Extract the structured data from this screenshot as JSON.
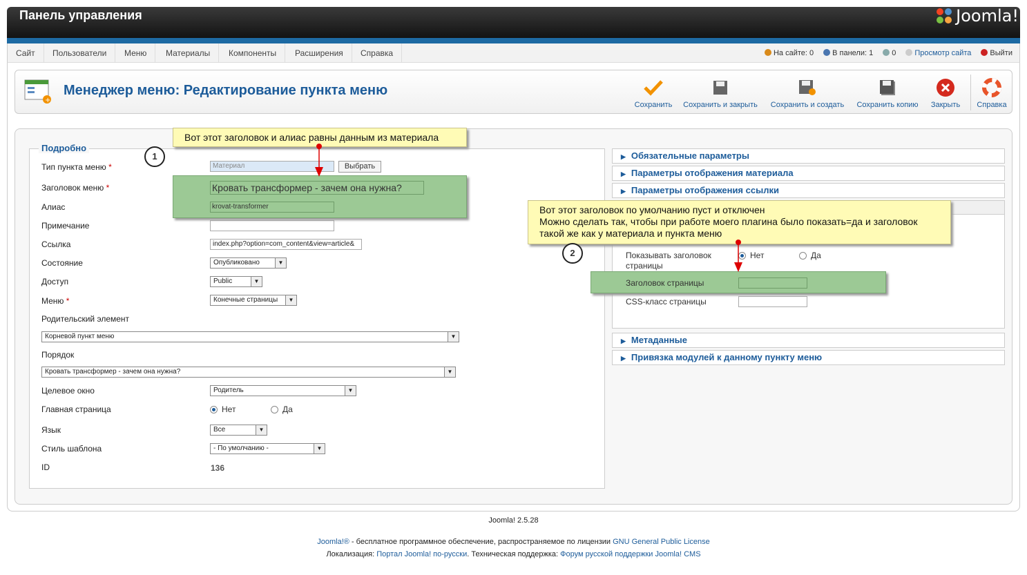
{
  "header": {
    "title": "Панель управления",
    "logo_text": "Joomla!"
  },
  "menu": [
    "Сайт",
    "Пользователи",
    "Меню",
    "Материалы",
    "Компоненты",
    "Расширения",
    "Справка"
  ],
  "status": {
    "on_site": "На сайте: 0",
    "in_panel": "В панели: 1",
    "messages": "0",
    "view_site": "Просмотр сайта",
    "logout": "Выйти"
  },
  "toolbar": {
    "title": "Менеджер меню: Редактирование пункта меню",
    "save": "Сохранить",
    "save_close": "Сохранить и закрыть",
    "save_new": "Сохранить и создать",
    "save_copy": "Сохранить копию",
    "close": "Закрыть",
    "help": "Справка"
  },
  "form": {
    "legend": "Подробно",
    "type_label": "Тип пункта меню",
    "type_value": "Материал",
    "select_button": "Выбрать",
    "title_label": "Заголовок меню",
    "title_value": "Кровать трансформер - зачем она нужна?",
    "alias_label": "Алиас",
    "alias_value": "krovat-transformer",
    "note_label": "Примечание",
    "note_value": "",
    "link_label": "Ссылка",
    "link_value": "index.php?option=com_content&view=article&",
    "state_label": "Состояние",
    "state_value": "Опубликовано",
    "access_label": "Доступ",
    "access_value": "Public",
    "menu_label": "Меню",
    "menu_value": "Конечные страницы",
    "parent_label": "Родительский элемент",
    "parent_value": "Корневой пункт меню",
    "order_label": "Порядок",
    "order_value": "Кровать трансформер - зачем она нужна?",
    "target_label": "Целевое окно",
    "target_value": "Родитель",
    "home_label": "Главная страница",
    "no": "Нет",
    "yes": "Да",
    "lang_label": "Язык",
    "lang_value": "Все",
    "style_label": "Стиль шаблона",
    "style_value": "- По умолчанию -",
    "id_label": "ID",
    "id_value": "136"
  },
  "accordion": {
    "required": "Обязательные параметры",
    "article_display": "Параметры отображения материала",
    "link_display": "Параметры отображения ссылки",
    "metadata": "Метаданные",
    "modules": "Привязка модулей к данному пункту меню"
  },
  "page_display": {
    "show_title_label": "Показывать заголовок страницы",
    "no": "Нет",
    "yes": "Да",
    "page_heading_label": "Заголовок страницы",
    "css_label": "CSS-класс страницы"
  },
  "notes": {
    "note1": "Вот этот заголовок и алиас равны данным из материала",
    "note2_line1": "Вот этот заголовок по умолчанию пуст и отключен",
    "note2_line2": "Можно сделать так, чтобы при работе моего плагина было показать=да и заголовок",
    "note2_line3": "такой же как у материала и пункта меню",
    "marker1": "1",
    "marker2": "2"
  },
  "footer": {
    "version": "Joomla! 2.5.28",
    "line2_a": "Joomla!®",
    "line2_b": " - бесплатное программное обеспечение, распространяемое по лицензии ",
    "line2_c": "GNU General Public License",
    "line3_a": "Локализация: ",
    "line3_b": "Портал Joomla! по-русски",
    "line3_c": ". Техническая поддержка: ",
    "line3_d": "Форум русской поддержки Joomla! CMS"
  }
}
